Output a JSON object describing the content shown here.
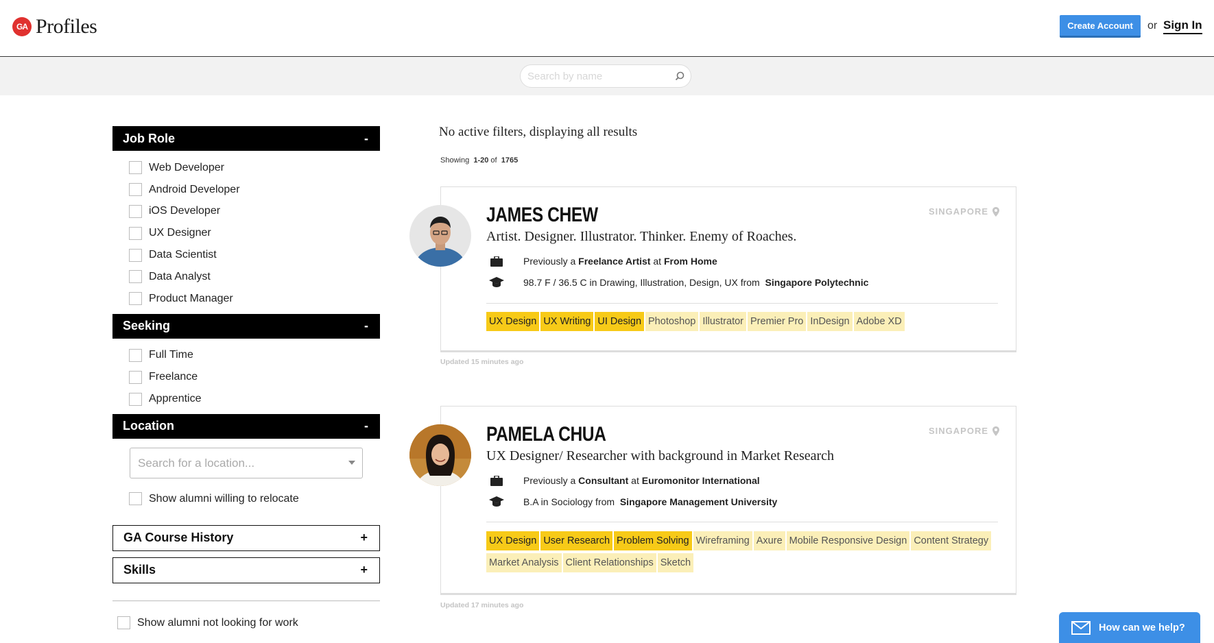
{
  "header": {
    "logo_badge": "GA",
    "logo_text": "Profiles",
    "create_account": "Create Account",
    "or": "or",
    "sign_in": "Sign In"
  },
  "search": {
    "placeholder": "Search by name"
  },
  "sidebar": {
    "job_role": {
      "title": "Job Role",
      "toggle": "-",
      "options": [
        "Web Developer",
        "Android Developer",
        "iOS Developer",
        "UX Designer",
        "Data Scientist",
        "Data Analyst",
        "Product Manager"
      ]
    },
    "seeking": {
      "title": "Seeking",
      "toggle": "-",
      "options": [
        "Full Time",
        "Freelance",
        "Apprentice"
      ]
    },
    "location": {
      "title": "Location",
      "toggle": "-",
      "placeholder": "Search for a location...",
      "relocate": "Show alumni willing to relocate"
    },
    "course_history": {
      "title": "GA Course History",
      "toggle": "+"
    },
    "skills": {
      "title": "Skills",
      "toggle": "+"
    },
    "not_looking": "Show alumni not looking for work"
  },
  "results": {
    "filters_note": "No active filters, displaying all results",
    "showing_prefix": "Showing",
    "showing_range": "1-20",
    "showing_of": "of",
    "showing_total": "1765"
  },
  "profiles": [
    {
      "name": "JAMES CHEW",
      "tagline": "Artist. Designer. Illustrator. Thinker. Enemy of Roaches.",
      "location": "SINGAPORE",
      "job_prefix": "Previously a",
      "job_title": "Freelance Artist",
      "job_at": "at",
      "job_company": "From Home",
      "edu_text": "98.7 F / 36.5 C in Drawing, Illustration, Design, UX from",
      "edu_school": "Singapore Polytechnic",
      "tags_hi": [
        "UX Design",
        "UX Writing",
        "UI Design"
      ],
      "tags": [
        "Photoshop",
        "Illustrator",
        "Premier Pro",
        "InDesign",
        "Adobe XD"
      ],
      "updated": "Updated 15 minutes ago"
    },
    {
      "name": "PAMELA CHUA",
      "tagline": "UX Designer/ Researcher with background in Market Research",
      "location": "SINGAPORE",
      "job_prefix": "Previously a",
      "job_title": "Consultant",
      "job_at": "at",
      "job_company": "Euromonitor International",
      "edu_text": "B.A in Sociology from",
      "edu_school": "Singapore Management University",
      "tags_hi": [
        "UX Design",
        "User Research",
        "Problem Solving"
      ],
      "tags": [
        "Wireframing",
        "Axure",
        "Mobile Responsive Design",
        "Content Strategy",
        "Market Analysis",
        "Client Relationships",
        "Sketch"
      ],
      "updated": "Updated 17 minutes ago"
    }
  ],
  "help": {
    "label": "How can we help?"
  },
  "colors": {
    "accent": "#3d8fe6",
    "brand": "#e0312f",
    "tag_highlight": "#f7ca18",
    "tag": "#fbefb8"
  }
}
